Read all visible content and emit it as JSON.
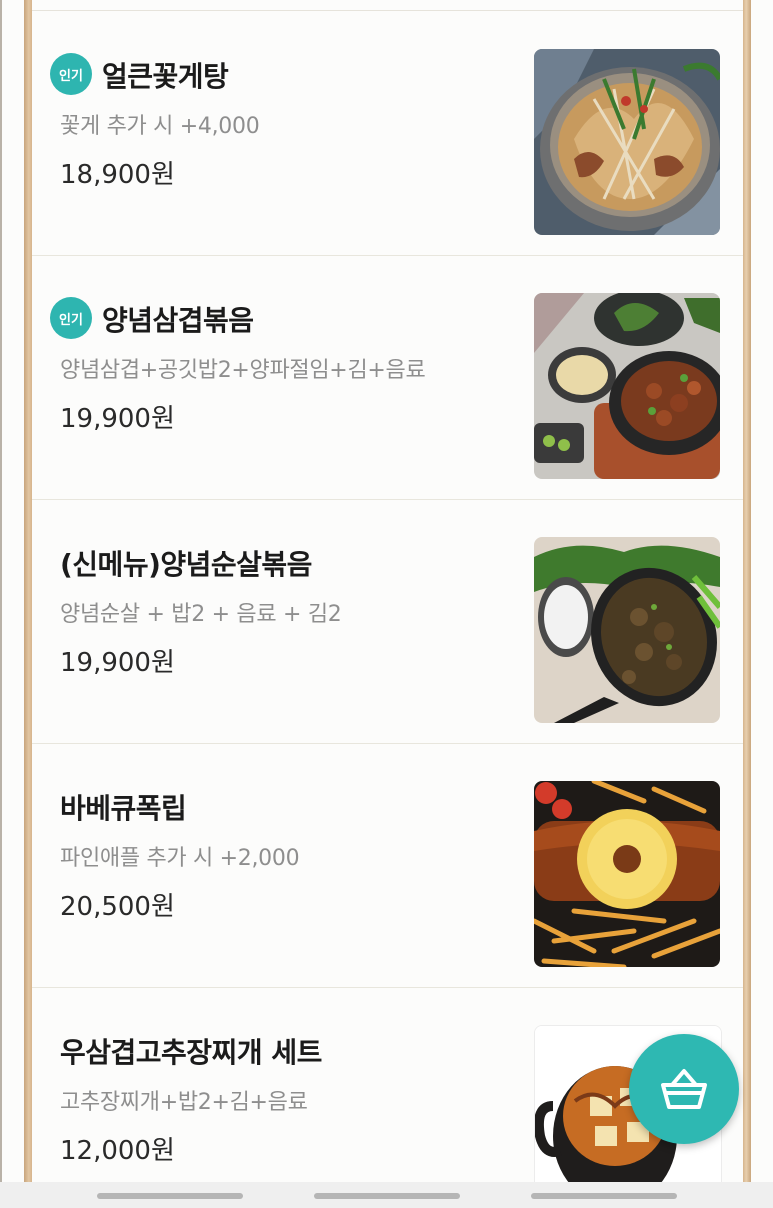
{
  "menu": {
    "items": [
      {
        "name": "얼큰꽃게탕",
        "badge": "인기",
        "desc": "꽃게 추가 시 +4,000",
        "price": "18,900원",
        "image_icon": "crab-stew-photo"
      },
      {
        "name": "양념삼겹볶음",
        "badge": "인기",
        "desc": "양념삼겹+공깃밥2+양파절임+김+음료",
        "price": "19,900원",
        "image_icon": "spicy-pork-belly-photo"
      },
      {
        "name": "(신메뉴)양념순살볶음",
        "badge": "",
        "desc": "양념순살 + 밥2 + 음료 + 김2",
        "price": "19,900원",
        "image_icon": "boneless-chicken-stirfry-photo"
      },
      {
        "name": "바베큐폭립",
        "badge": "",
        "desc": "파인애플 추가 시 +2,000",
        "price": "20,500원",
        "image_icon": "bbq-pork-ribs-photo"
      },
      {
        "name": "우삼겹고추장찌개 세트",
        "badge": "",
        "desc": "고추장찌개+밥2+김+음료",
        "price": "12,000원",
        "image_icon": "gochujang-stew-photo"
      }
    ]
  },
  "cart_button": {
    "icon": "basket-icon"
  },
  "colors": {
    "accent": "#2eb5b0",
    "frame": "#d6b48c",
    "price_text": "#2a2a2a",
    "desc_text": "#8e8e8e"
  }
}
